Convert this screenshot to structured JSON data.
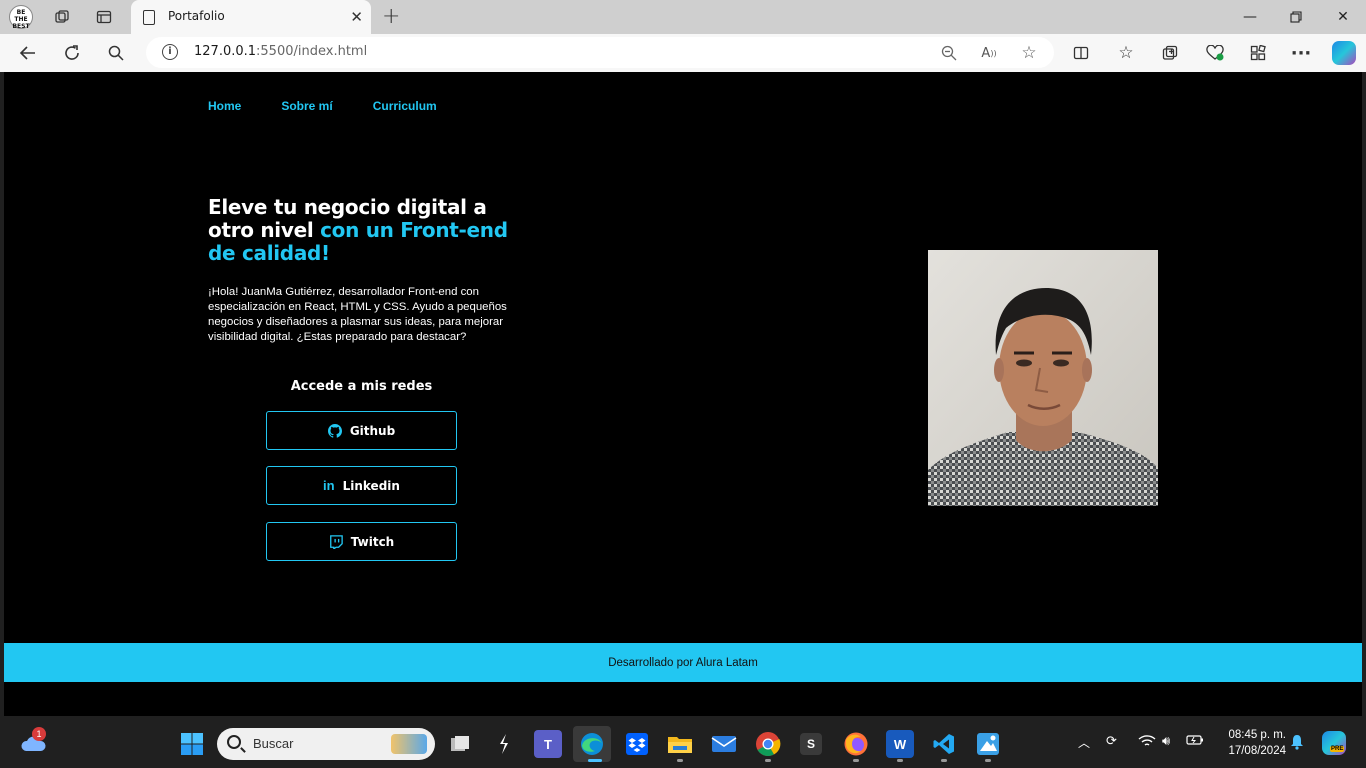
{
  "browser": {
    "tab_title": "Portafolio",
    "url_host": "127.0.0.1",
    "url_rest": ":5500/index.html",
    "icons": [
      "profile-avatar",
      "workspaces-icon",
      "tab-actions-icon",
      "close-icon",
      "new-tab-icon",
      "minimize-icon",
      "restore-icon",
      "window-close-icon",
      "back-icon",
      "refresh-icon",
      "search-icon",
      "info-icon",
      "zoom-out-icon",
      "read-aloud-icon",
      "favorite-star-icon",
      "split-screen-icon",
      "favorites-icon",
      "collections-icon",
      "browser-essentials-icon",
      "extensions-icon",
      "more-icon",
      "copilot-icon"
    ],
    "profile_label": "BE THE BEST"
  },
  "page": {
    "nav": [
      {
        "label": "Home"
      },
      {
        "label": "Sobre mí"
      },
      {
        "label": "Curriculum"
      }
    ],
    "hero": {
      "title_plain": "Eleve tu negocio digital a otro nivel ",
      "title_accent": "con un Front-end de calidad!",
      "text": "¡Hola! JuanMa Gutiérrez, desarrollador Front-end con especialización en React, HTML y CSS. Ayudo a pequeños negocios y diseñadores a plasmar sus ideas, para mejorar visibilidad digital. ¿Estas preparado para destacar?"
    },
    "social": {
      "heading": "Accede a mis redes",
      "buttons": [
        {
          "label": "Github",
          "icon": "github-icon"
        },
        {
          "label": "Linkedin",
          "icon": "linkedin-icon"
        },
        {
          "label": "Twitch",
          "icon": "twitch-icon"
        }
      ]
    },
    "footer": "Desarrollado por Alura Latam",
    "accent_color": "#22c7f2",
    "background_color": "#000000"
  },
  "taskbar": {
    "search_placeholder": "Buscar",
    "notification_badge": "1",
    "time": "08:45 p. m.",
    "date": "17/08/2024",
    "apps": [
      "start-icon",
      "task-view-icon",
      "sublime-icon",
      "teams-icon",
      "edge-icon",
      "dropbox-icon",
      "file-explorer-icon",
      "mail-icon",
      "chrome-icon",
      "s-app-icon",
      "firefox-icon",
      "word-icon",
      "vscode-icon",
      "paint-icon"
    ],
    "copilot_badge": "PRE"
  }
}
